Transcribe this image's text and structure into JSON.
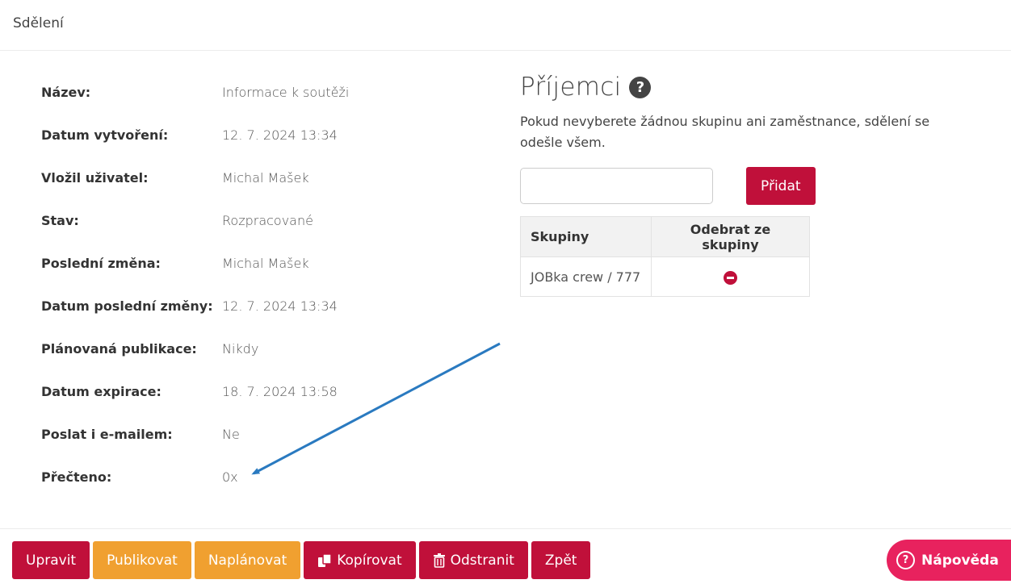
{
  "header": {
    "title": "Sdělení"
  },
  "details": [
    {
      "label": "Název:",
      "value": "Informace k soutěži"
    },
    {
      "label": "Datum vytvoření:",
      "value": "12. 7. 2024 13:34"
    },
    {
      "label": "Vložil uživatel:",
      "value": "Michal Mašek"
    },
    {
      "label": "Stav:",
      "value": "Rozpracované"
    },
    {
      "label": "Poslední změna:",
      "value": "Michal Mašek"
    },
    {
      "label": "Datum poslední změny:",
      "value": "12. 7. 2024 13:34"
    },
    {
      "label": "Plánovaná publikace:",
      "value": "Nikdy"
    },
    {
      "label": "Datum expirace:",
      "value": "18. 7. 2024 13:58"
    },
    {
      "label": "Poslat i e-mailem:",
      "value": "Ne"
    },
    {
      "label": "Přečteno:",
      "value": "0x"
    }
  ],
  "recipients": {
    "title": "Příjemci",
    "help_icon": "?",
    "description": "Pokud nevyberete žádnou skupinu ani zaměstnance, sdělení se odešle všem.",
    "input_value": "",
    "add_label": "Přidat",
    "table": {
      "headers": [
        "Skupiny",
        "Odebrat ze skupiny"
      ],
      "rows": [
        {
          "group": "JOBka crew / 777",
          "remove_icon": "remove-circle-icon"
        }
      ]
    }
  },
  "annotation": {
    "color": "#2a7ac0"
  },
  "footer": {
    "buttons": {
      "edit": "Upravit",
      "publish": "Publikovat",
      "schedule": "Naplánovat",
      "copy": "Kopírovat",
      "delete": "Odstranit",
      "back": "Zpět"
    },
    "help": "Nápověda"
  },
  "colors": {
    "primary": "#c0103a",
    "secondary": "#f0a030",
    "help": "#e8225e"
  }
}
